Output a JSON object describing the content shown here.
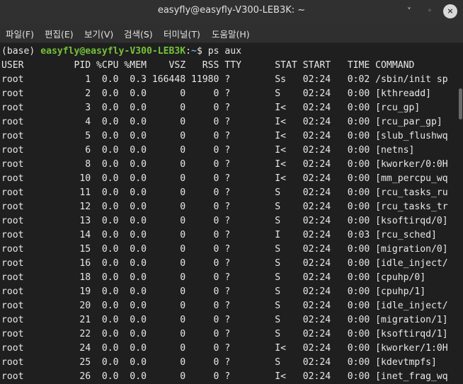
{
  "window": {
    "title": "easyfly@easyfly-V300-LEB3K: ~",
    "minimize_icon": "˅",
    "maximize_icon": "◦",
    "close_icon": "×"
  },
  "menu": [
    "파일(F)",
    "편집(E)",
    "보기(V)",
    "검색(S)",
    "터미널(T)",
    "도움말(H)"
  ],
  "prompt": {
    "env": "(base) ",
    "userhost": "easyfly@easyfly-V300-LEB3K",
    "sep": ":",
    "path": "~",
    "symbol": "$ ",
    "command": "ps aux"
  },
  "ps_header": "USER         PID %CPU %MEM    VSZ   RSS TTY      STAT START   TIME COMMAND",
  "ps_rows": [
    "root           1  0.0  0.3 166448 11980 ?        Ss   02:24   0:02 /sbin/init sp",
    "root           2  0.0  0.0      0     0 ?        S    02:24   0:00 [kthreadd]",
    "root           3  0.0  0.0      0     0 ?        I<   02:24   0:00 [rcu_gp]",
    "root           4  0.0  0.0      0     0 ?        I<   02:24   0:00 [rcu_par_gp]",
    "root           5  0.0  0.0      0     0 ?        I<   02:24   0:00 [slub_flushwq",
    "root           6  0.0  0.0      0     0 ?        I<   02:24   0:00 [netns]",
    "root           8  0.0  0.0      0     0 ?        I<   02:24   0:00 [kworker/0:0H",
    "root          10  0.0  0.0      0     0 ?        I<   02:24   0:00 [mm_percpu_wq",
    "root          11  0.0  0.0      0     0 ?        S    02:24   0:00 [rcu_tasks_ru",
    "root          12  0.0  0.0      0     0 ?        S    02:24   0:00 [rcu_tasks_tr",
    "root          13  0.0  0.0      0     0 ?        S    02:24   0:00 [ksoftirqd/0]",
    "root          14  0.0  0.0      0     0 ?        I    02:24   0:03 [rcu_sched]",
    "root          15  0.0  0.0      0     0 ?        S    02:24   0:00 [migration/0]",
    "root          16  0.0  0.0      0     0 ?        S    02:24   0:00 [idle_inject/",
    "root          18  0.0  0.0      0     0 ?        S    02:24   0:00 [cpuhp/0]",
    "root          19  0.0  0.0      0     0 ?        S    02:24   0:00 [cpuhp/1]",
    "root          20  0.0  0.0      0     0 ?        S    02:24   0:00 [idle_inject/",
    "root          21  0.0  0.0      0     0 ?        S    02:24   0:00 [migration/1]",
    "root          22  0.0  0.0      0     0 ?        S    02:24   0:00 [ksoftirqd/1]",
    "root          24  0.0  0.0      0     0 ?        I<   02:24   0:00 [kworker/1:0H",
    "root          25  0.0  0.0      0     0 ?        S    02:24   0:00 [kdevtmpfs]",
    "root          26  0.0  0.0      0     0 ?        I<   02:24   0:00 [inet_frag_wq"
  ]
}
